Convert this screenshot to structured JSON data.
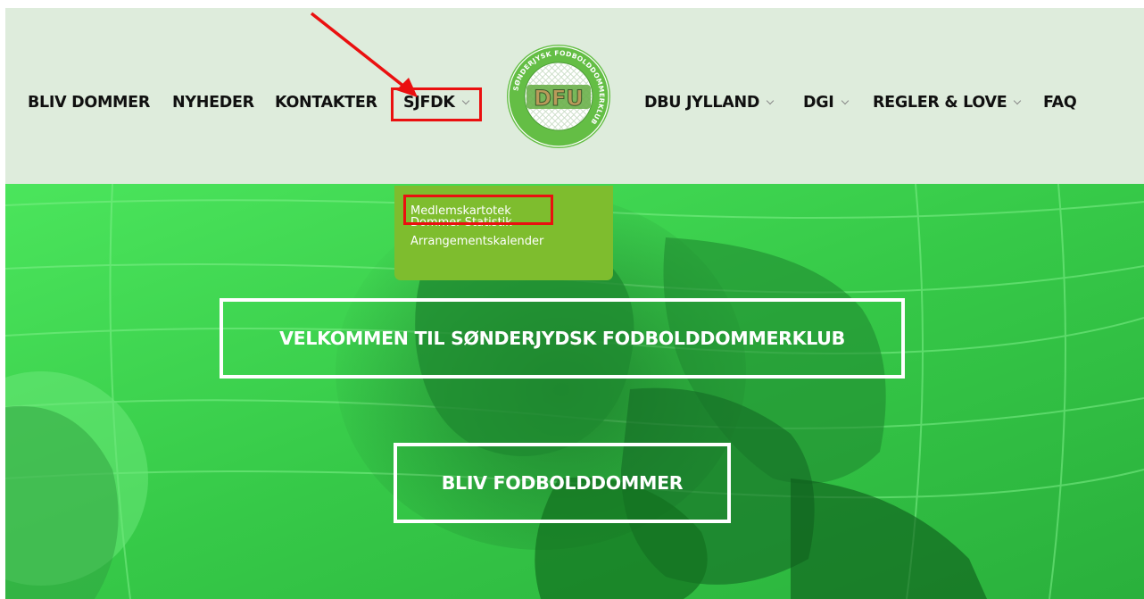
{
  "nav": {
    "left": [
      {
        "label": "BLIV DOMMER",
        "dropdown": false
      },
      {
        "label": "NYHEDER",
        "dropdown": false
      },
      {
        "label": "KONTAKTER",
        "dropdown": false
      },
      {
        "label": "SJFDK",
        "dropdown": true
      }
    ],
    "right": [
      {
        "label": "DBU JYLLAND",
        "dropdown": true
      },
      {
        "label": "DGI",
        "dropdown": true
      },
      {
        "label": "REGLER & LOVE",
        "dropdown": true
      },
      {
        "label": "FAQ",
        "dropdown": false
      }
    ]
  },
  "logo": {
    "ring_text": "SØNDERJYSK FODBOLDDOMMERKLUB",
    "center_text": "DFU"
  },
  "dropdown": {
    "items": [
      "Medlemskartotek",
      "Dommer Statistik",
      "Arrangementskalender"
    ]
  },
  "hero": {
    "welcome": "VELKOMMEN TIL SØNDERJYDSK FODBOLDDOMMERKLUB",
    "cta": "BLIV FODBOLDDOMMER"
  },
  "colors": {
    "header_bg": "#deecdc",
    "hero_green": "#3fd650",
    "dropdown_bg": "#7ebd2e",
    "annotation": "#ea1010"
  }
}
